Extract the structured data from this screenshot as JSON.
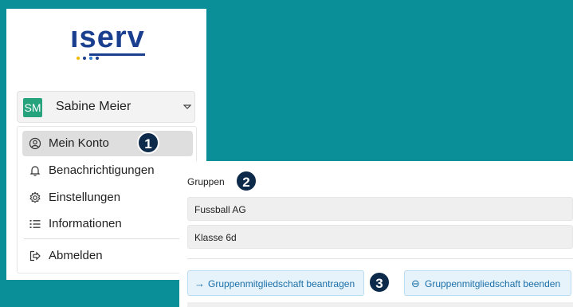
{
  "brand": {
    "logo_text": "ıserv",
    "dot_colors": [
      "#f5b800",
      "#1a3f8f",
      "#2e7fd6",
      "#1a3f8f"
    ]
  },
  "user": {
    "initials": "SM",
    "name": "Sabine Meier",
    "avatar_color": "#26a37d"
  },
  "menu": {
    "items": [
      {
        "label": "Mein Konto",
        "icon": "account-circle-icon",
        "active": true
      },
      {
        "label": "Benachrichtigungen",
        "icon": "bell-icon",
        "active": false
      },
      {
        "label": "Einstellungen",
        "icon": "gear-icon",
        "active": false
      },
      {
        "label": "Informationen",
        "icon": "list-icon",
        "active": false
      },
      {
        "label": "Abmelden",
        "icon": "logout-icon",
        "active": false
      }
    ]
  },
  "groups": {
    "title": "Gruppen",
    "items": [
      "Fussball AG",
      "Klasse 6d"
    ]
  },
  "actions": {
    "request": "Gruppenmitgliedschaft beantragen",
    "end": "Gruppenmitgliedschaft beenden",
    "request_arrow": "→",
    "end_arrow": "⊖"
  },
  "badges": {
    "one": "1",
    "two": "2",
    "three": "3"
  },
  "colors": {
    "background": "#0a8f98",
    "badge": "#0e2a4a",
    "link": "#1c6fa8"
  }
}
